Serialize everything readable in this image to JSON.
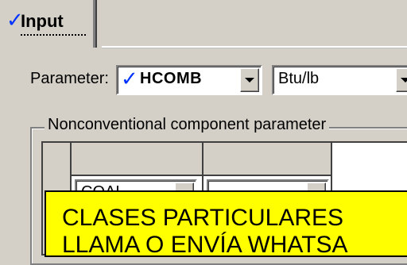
{
  "tabs": [
    {
      "label": "Input",
      "checked": true
    }
  ],
  "parameter": {
    "label": "Parameter:",
    "value": "HCOMB",
    "value_checked": true,
    "units": "Btu/lb"
  },
  "nonconventional": {
    "group_title": "Nonconventional component parameter",
    "columns": [
      {
        "value": "COAL"
      },
      {
        "value": ""
      }
    ]
  },
  "ad_overlay": {
    "line1": "CLASES PARTICULARES",
    "line2": "LLAMA O ENVÍA WHATSA"
  },
  "colors": {
    "window_bg": "#d4d0c8",
    "check_blue": "#0033ff",
    "ad_bg": "#ffff00"
  },
  "icons": [
    "checkmark-icon",
    "dropdown-arrow-icon"
  ]
}
